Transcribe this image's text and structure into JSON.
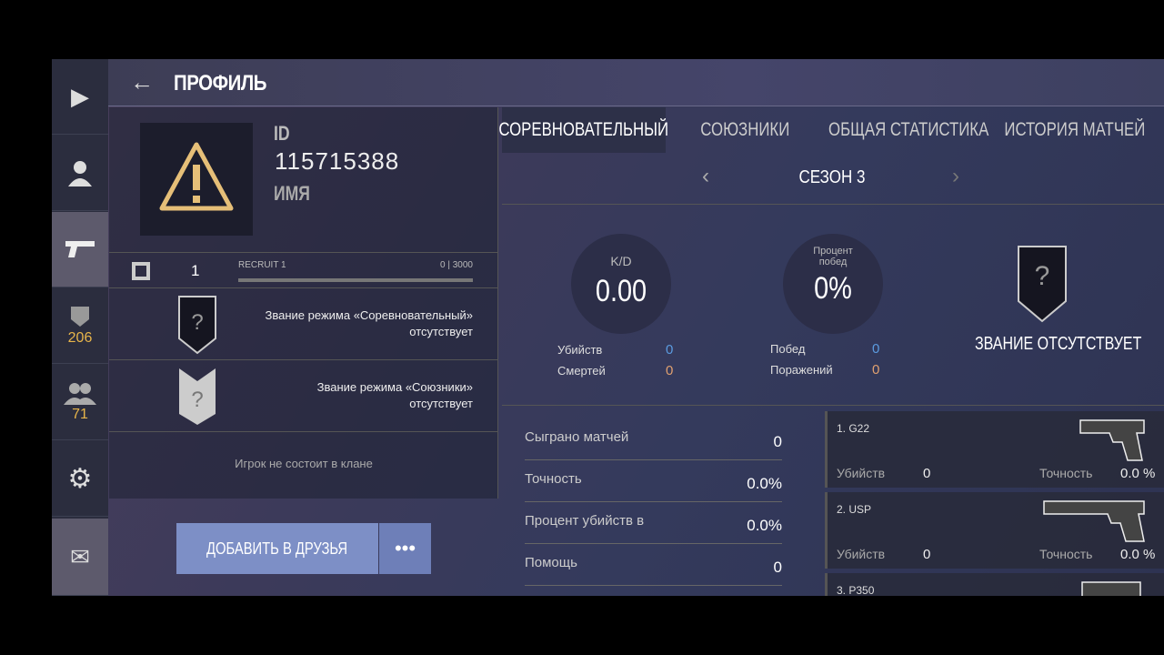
{
  "sidebar": {
    "items": [
      {
        "icon": "play-icon",
        "label": ""
      },
      {
        "icon": "user-icon",
        "label": ""
      },
      {
        "icon": "pistol-icon",
        "label": ""
      },
      {
        "icon": "rank-emblem-icon",
        "count": "206"
      },
      {
        "icon": "friends-icon",
        "count": "71"
      },
      {
        "icon": "gear-icon",
        "label": ""
      },
      {
        "icon": "mail-icon",
        "label": ""
      }
    ]
  },
  "header": {
    "title": "ПРОФИЛЬ"
  },
  "profile": {
    "id_label": "ID",
    "id_value": "115715388",
    "name_label": "ИМЯ",
    "level": "1",
    "rank_name": "RECRUIT 1",
    "xp": "0 | 3000",
    "xp_progress": 0,
    "ranks": [
      {
        "line1": "Звание режима «Соревновательный»",
        "line2": "отсутствует"
      },
      {
        "line1": "Звание режима «Союзники»",
        "line2": "отсутствует"
      }
    ],
    "clan": "Игрок не состоит в клане",
    "add_friend": "ДОБАВИТЬ В ДРУЗЬЯ",
    "more": "•••"
  },
  "tabs": [
    {
      "label": "СОРЕВНОВАТЕЛЬНЫЙ",
      "active": true
    },
    {
      "label": "СОЮЗНИКИ"
    },
    {
      "label": "ОБЩАЯ СТАТИСТИКА"
    },
    {
      "label": "ИСТОРИЯ МАТЧЕЙ"
    }
  ],
  "season": {
    "label": "СЕЗОН 3",
    "prev": "‹",
    "next": "›"
  },
  "kd": {
    "label": "K/D",
    "value": "0.00",
    "kills_label": "Убийств",
    "kills": "0",
    "deaths_label": "Смертей",
    "deaths": "0"
  },
  "winrate": {
    "label1": "Процент",
    "label2": "побед",
    "value": "0%",
    "wins_label": "Побед",
    "wins": "0",
    "losses_label": "Поражений",
    "losses": "0"
  },
  "rank_status": "ЗВАНИЕ ОТСУТСТВУЕТ",
  "stats": [
    {
      "label": "Сыграно матчей",
      "value": "0"
    },
    {
      "label": "Точность",
      "value": "0.0%"
    },
    {
      "label": "Процент убийств в",
      "value": "0.0%"
    },
    {
      "label": "Помощь",
      "value": "0"
    }
  ],
  "weapons": [
    {
      "name": "1. G22",
      "kills_label": "Убийств",
      "kills": "0",
      "acc_label": "Точность",
      "acc": "0.0 %"
    },
    {
      "name": "2. USP",
      "kills_label": "Убийств",
      "kills": "0",
      "acc_label": "Точность",
      "acc": "0.0 %"
    },
    {
      "name": "3. P350"
    }
  ],
  "colors": {
    "accent_blue": "#5b9be0",
    "accent_orange": "#e0a070",
    "gold": "#e8b54a",
    "button": "#7d8fc6"
  }
}
